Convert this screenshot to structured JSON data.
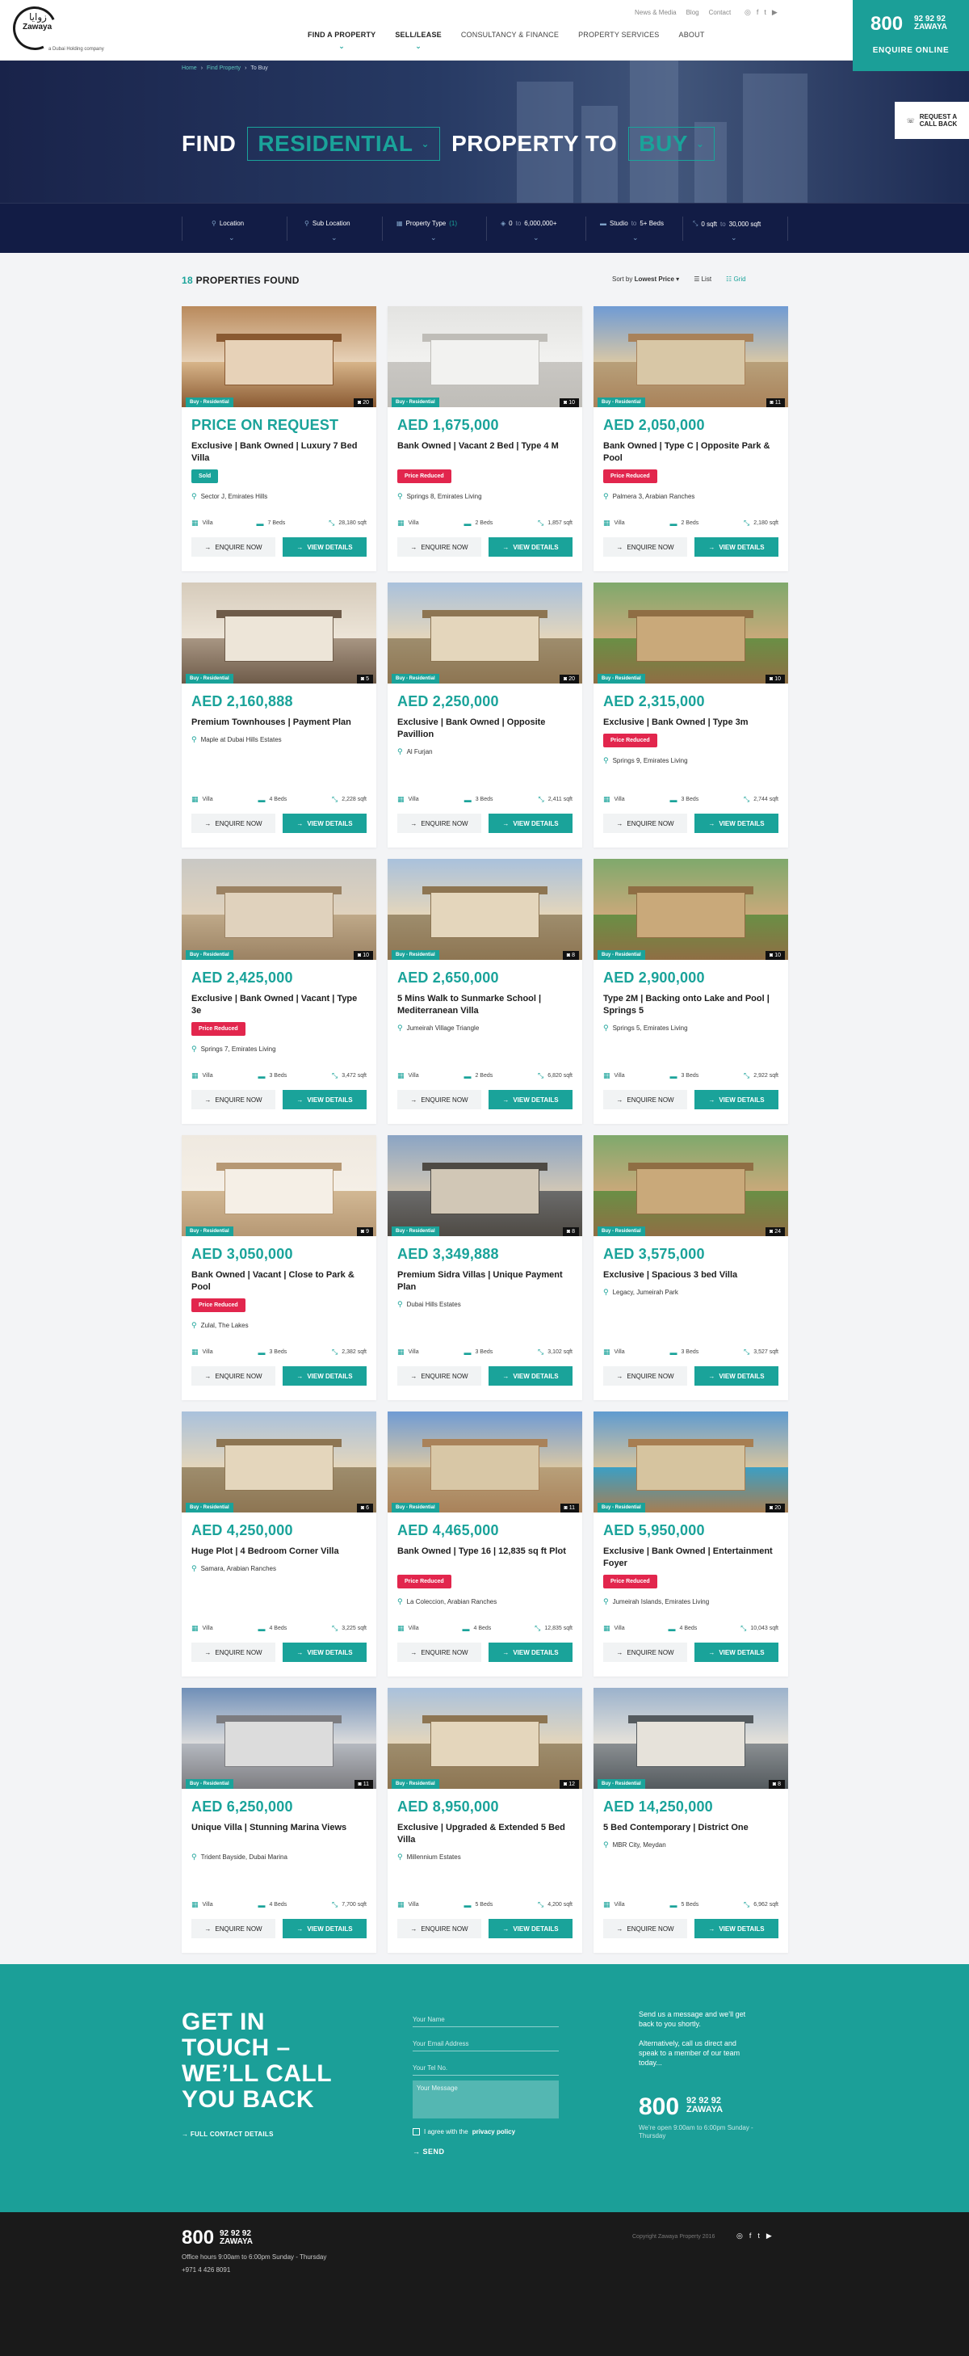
{
  "header": {
    "logo": {
      "latin": "Zawaya",
      "arabic": "زوايا",
      "sub": "a Dubai Holding company"
    },
    "top_links": [
      "News & Media",
      "Blog",
      "Contact"
    ],
    "social_icons": [
      "instagram-icon",
      "facebook-icon",
      "twitter-icon",
      "youtube-icon"
    ],
    "nav": [
      {
        "label": "FIND A PROPERTY",
        "has_dropdown": true,
        "bold": true
      },
      {
        "label": "SELL/LEASE",
        "has_dropdown": true,
        "bold": true
      },
      {
        "label": "CONSULTANCY & FINANCE",
        "has_dropdown": false,
        "bold": false
      },
      {
        "label": "PROPERTY SERVICES",
        "has_dropdown": false,
        "bold": false
      },
      {
        "label": "ABOUT",
        "has_dropdown": false,
        "bold": false
      }
    ],
    "phone": {
      "big": "800",
      "line1": "92 92 92",
      "line2": "ZAWAYA",
      "cta": "ENQUIRE ONLINE"
    }
  },
  "hero": {
    "breadcrumb": [
      "Home",
      "Find Property",
      "To Buy"
    ],
    "find": "FIND",
    "type": "RESIDENTIAL",
    "middle": "PROPERTY TO",
    "mode": "BUY",
    "callback": {
      "line1": "REQUEST A",
      "line2": "CALL BACK"
    },
    "filters": {
      "location": "Location",
      "sub_location": "Sub Location",
      "property_type": "Property Type",
      "property_type_count": "(1)",
      "price_min": "0",
      "price_to": "to",
      "price_max": "6,000,000+",
      "beds_min": "Studio",
      "beds_to": "to",
      "beds_max": "5+ Beds",
      "area_min": "0 sqft",
      "area_to": "to",
      "area_max": "30,000 sqft"
    }
  },
  "results": {
    "count": "18",
    "count_label": "PROPERTIES FOUND",
    "sort_label": "Sort by",
    "sort_value": "Lowest Price",
    "view_list": "List",
    "view_grid": "Grid"
  },
  "card_labels": {
    "tag": "Buy - Residential",
    "enquire": "ENQUIRE NOW",
    "view": "VIEW DETAILS"
  },
  "listings": [
    {
      "price": "PRICE ON REQUEST",
      "title": "Exclusive | Bank Owned | Luxury 7 Bed Villa",
      "badge": "Sold",
      "location": "Sector J, Emirates Hills",
      "type": "Villa",
      "beds": "7 Beds",
      "area": "28,180 sqft",
      "photos": "20",
      "tone": "interior-warm"
    },
    {
      "price": "AED 1,675,000",
      "title": "Bank Owned | Vacant 2 Bed | Type 4 M",
      "badge": "Price Reduced",
      "location": "Springs 8, Emirates Living",
      "type": "Villa",
      "beds": "2 Beds",
      "area": "1,857 sqft",
      "photos": "10",
      "tone": "interior-white"
    },
    {
      "price": "AED 2,050,000",
      "title": "Bank Owned | Type C | Opposite Park & Pool",
      "badge": "Price Reduced",
      "location": "Palmera 3, Arabian Ranches",
      "type": "Villa",
      "beds": "2 Beds",
      "area": "2,180 sqft",
      "photos": "11",
      "tone": "outdoor-sky"
    },
    {
      "price": "AED 2,160,888",
      "title": "Premium Townhouses | Payment Plan",
      "badge": "",
      "location": "Maple at Dubai Hills Estates",
      "type": "Villa",
      "beds": "4 Beds",
      "area": "2,228 sqft",
      "photos": "5",
      "tone": "interior-bedroom"
    },
    {
      "price": "AED 2,250,000",
      "title": "Exclusive | Bank Owned | Opposite Pavillion",
      "badge": "",
      "location": "Al Furjan",
      "type": "Villa",
      "beds": "3 Beds",
      "area": "2,411 sqft",
      "photos": "20",
      "tone": "outdoor-villa"
    },
    {
      "price": "AED 2,315,000",
      "title": "Exclusive | Bank Owned | Type 3m",
      "badge": "Price Reduced",
      "location": "Springs 9, Emirates Living",
      "type": "Villa",
      "beds": "3 Beds",
      "area": "2,744 sqft",
      "photos": "10",
      "tone": "outdoor-garden"
    },
    {
      "price": "AED 2,425,000",
      "title": "Exclusive | Bank Owned | Vacant | Type 3e",
      "badge": "Price Reduced",
      "location": "Springs 7, Emirates Living",
      "type": "Villa",
      "beds": "3 Beds",
      "area": "3,472 sqft",
      "photos": "10",
      "tone": "outdoor-roof"
    },
    {
      "price": "AED 2,650,000",
      "title": "5 Mins Walk to Sunmarke School | Mediterranean Villa",
      "badge": "",
      "location": "Jumeirah Village Triangle",
      "type": "Villa",
      "beds": "2 Beds",
      "area": "6,820 sqft",
      "photos": "8",
      "tone": "outdoor-villa"
    },
    {
      "price": "AED 2,900,000",
      "title": "Type 2M | Backing onto Lake and Pool | Springs 5",
      "badge": "",
      "location": "Springs 5, Emirates Living",
      "type": "Villa",
      "beds": "3 Beds",
      "area": "2,922 sqft",
      "photos": "10",
      "tone": "outdoor-garden"
    },
    {
      "price": "AED 3,050,000",
      "title": "Bank Owned | Vacant | Close to Park & Pool",
      "badge": "Price Reduced",
      "location": "Zulal, The Lakes",
      "type": "Villa",
      "beds": "3 Beds",
      "area": "2,382 sqft",
      "photos": "9",
      "tone": "interior-kitchen"
    },
    {
      "price": "AED 3,349,888",
      "title": "Premium Sidra Villas | Unique Payment Plan",
      "badge": "",
      "location": "Dubai Hills Estates",
      "type": "Villa",
      "beds": "3 Beds",
      "area": "3,102 sqft",
      "photos": "8",
      "tone": "outdoor-dusk"
    },
    {
      "price": "AED 3,575,000",
      "title": "Exclusive | Spacious 3 bed Villa",
      "badge": "",
      "location": "Legacy, Jumeirah Park",
      "type": "Villa",
      "beds": "3 Beds",
      "area": "3,527 sqft",
      "photos": "24",
      "tone": "outdoor-garden"
    },
    {
      "price": "AED 4,250,000",
      "title": "Huge Plot | 4 Bedroom Corner Villa",
      "badge": "",
      "location": "Samara, Arabian Ranches",
      "type": "Villa",
      "beds": "4 Beds",
      "area": "3,225 sqft",
      "photos": "6",
      "tone": "outdoor-villa"
    },
    {
      "price": "AED 4,465,000",
      "title": "Bank Owned | Type 16 | 12,835 sq ft Plot",
      "badge": "Price Reduced",
      "location": "La Coleccion, Arabian Ranches",
      "type": "Villa",
      "beds": "4 Beds",
      "area": "12,835 sqft",
      "photos": "11",
      "tone": "outdoor-sky"
    },
    {
      "price": "AED 5,950,000",
      "title": "Exclusive | Bank Owned | Entertainment Foyer",
      "badge": "Price Reduced",
      "location": "Jumeirah Islands, Emirates Living",
      "type": "Villa",
      "beds": "4 Beds",
      "area": "10,043 sqft",
      "photos": "20",
      "tone": "outdoor-pool"
    },
    {
      "price": "AED 6,250,000",
      "title": "Unique Villa | Stunning Marina Views",
      "badge": "",
      "location": "Trident Bayside, Dubai Marina",
      "type": "Villa",
      "beds": "4 Beds",
      "area": "7,700 sqft",
      "photos": "11",
      "tone": "outdoor-city"
    },
    {
      "price": "AED 8,950,000",
      "title": "Exclusive | Upgraded & Extended 5 Bed Villa",
      "badge": "",
      "location": "Millennium Estates",
      "type": "Villa",
      "beds": "5 Beds",
      "area": "4,200 sqft",
      "photos": "12",
      "tone": "outdoor-villa"
    },
    {
      "price": "AED 14,250,000",
      "title": "5 Bed Contemporary | District One",
      "badge": "",
      "location": "MBR City, Meydan",
      "type": "Villa",
      "beds": "5 Beds",
      "area": "6,962 sqft",
      "photos": "8",
      "tone": "outdoor-modern"
    }
  ],
  "contact": {
    "heading": "GET IN TOUCH – WE’LL CALL YOU BACK",
    "full_contact": "FULL CONTACT DETAILS",
    "name_ph": "Your Name",
    "email_ph": "Your Email Address",
    "tel_ph": "Your Tel No.",
    "message_ph": "Your Message",
    "agree_prefix": "I agree with the",
    "agree_link": "privacy policy",
    "send": "SEND",
    "right_p1": "Send us a message and we’ll get back to you shortly.",
    "right_p2": "Alternatively, call us direct and speak to a member of our team today...",
    "big": "800",
    "line1": "92 92 92",
    "line2": "ZAWAYA",
    "hours": "We’re open 9:00am to 6:00pm Sunday - Thursday"
  },
  "footer": {
    "big": "800",
    "line1": "92 92 92",
    "line2": "ZAWAYA",
    "hours": "Office hours 9:00am to 6:00pm Sunday - Thursday",
    "phone": "+971 4 426 8091",
    "copyright": "Copyright Zawaya Property 2016",
    "social_icons": [
      "instagram-icon",
      "facebook-icon",
      "twitter-icon",
      "youtube-icon"
    ]
  },
  "colors": {
    "accent": "#1aa39a",
    "navy": "#121c45",
    "red_badge": "#e2264d",
    "footer": "#1a1a1a"
  }
}
